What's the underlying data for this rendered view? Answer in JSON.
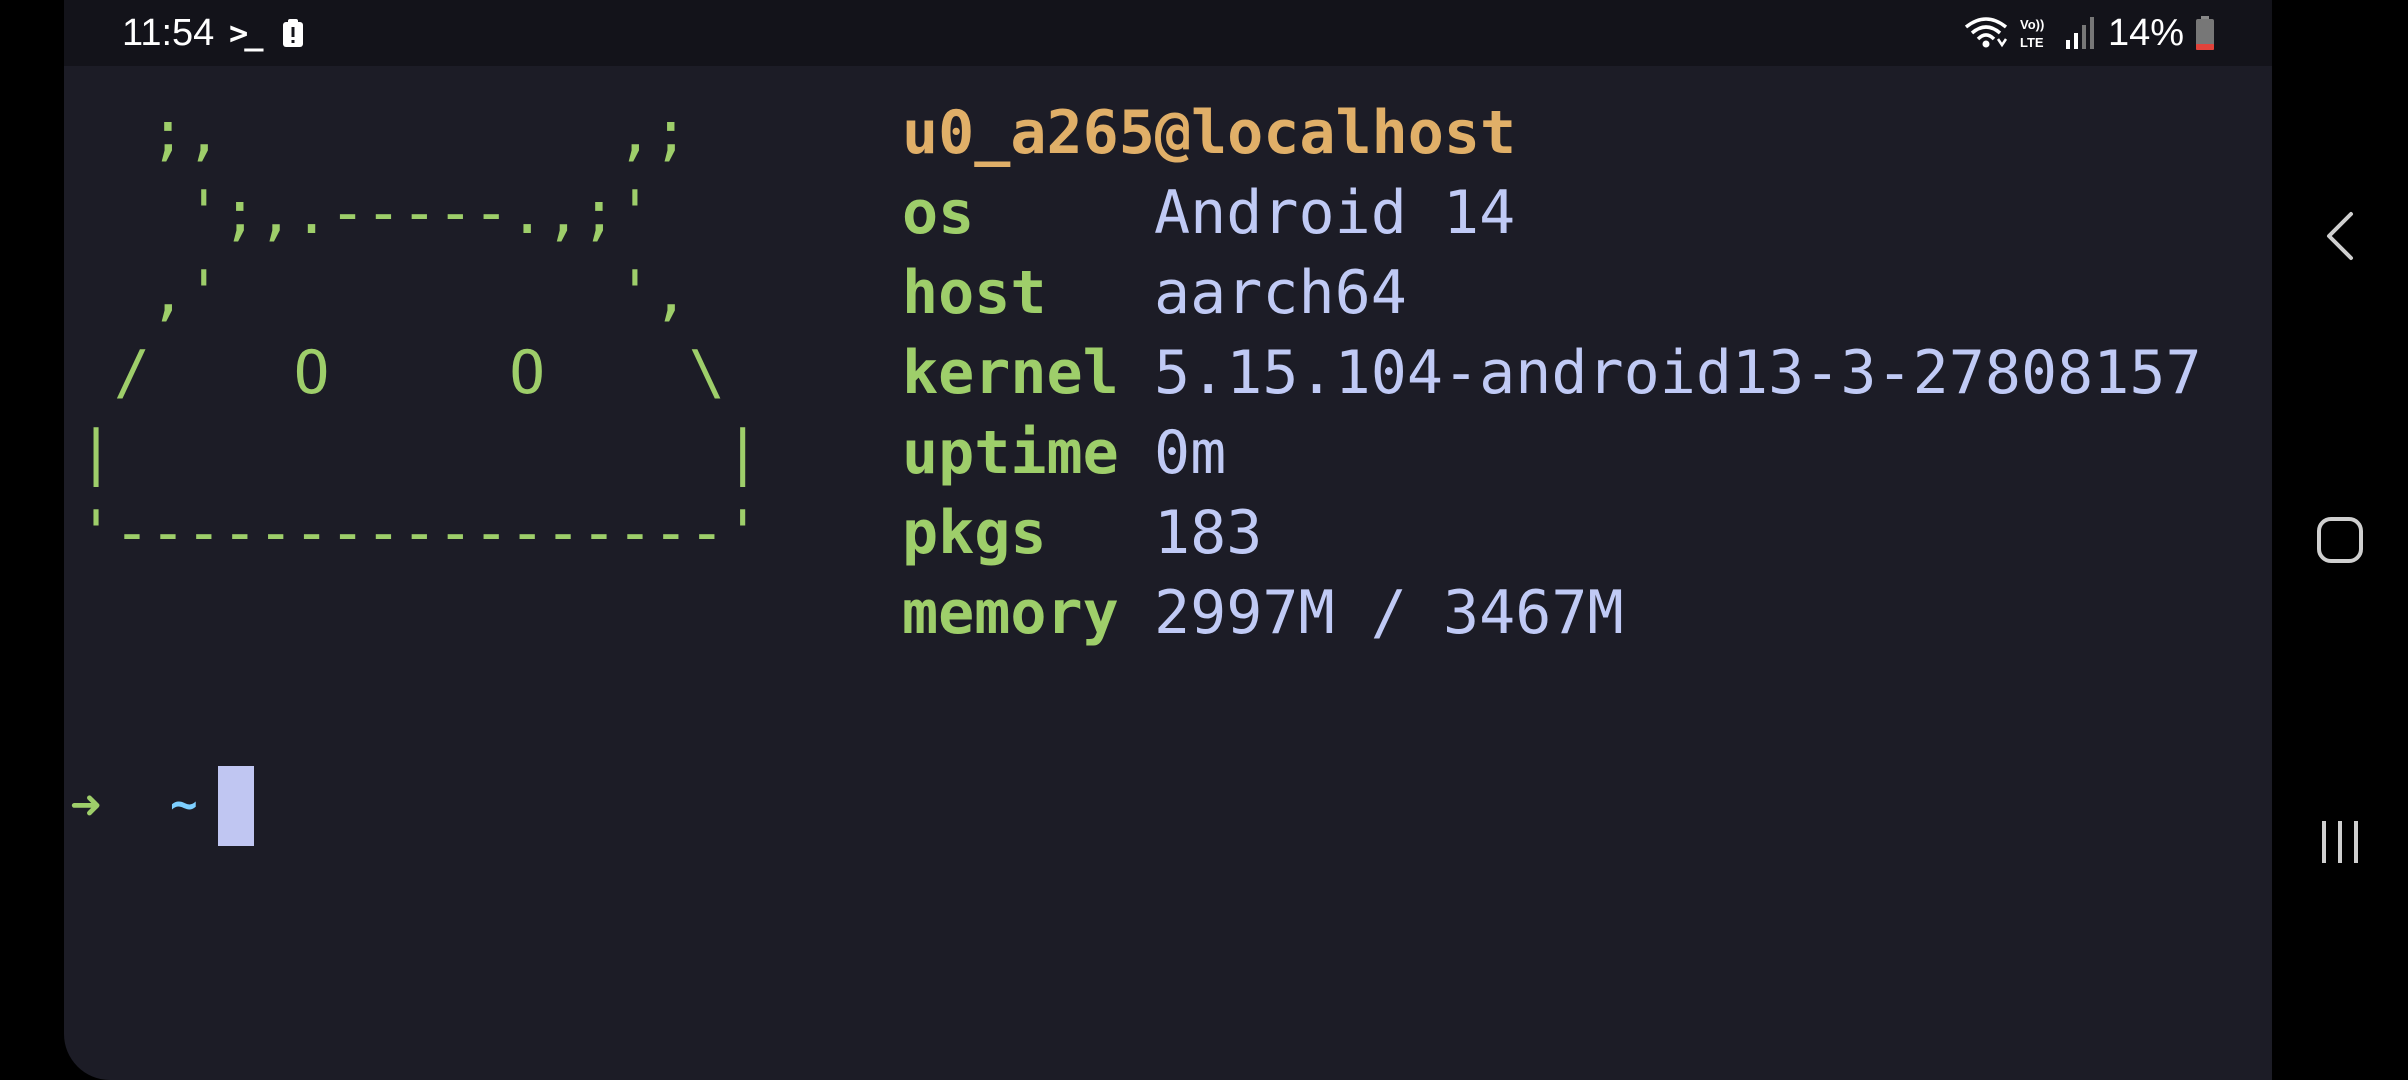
{
  "status_bar": {
    "time": "11:54",
    "terminal_icon": "terminal-prompt-icon",
    "clipboard_icon": "clipboard-alert-icon",
    "wifi_icon": "wifi-icon",
    "volte_icon": "volte-lte-icon",
    "signal_icon": "cell-signal-icon",
    "battery_percent": "14%",
    "battery_icon": "battery-low-icon",
    "battery_level": 0.14
  },
  "terminal": {
    "ascii_art": "  ;,           ,;\n   ';,.-----.,;'\n  ,'           ',\n /    O     O    \\\n|                 |\n'-----------------'",
    "user_host": "u0_a265@localhost",
    "info": [
      {
        "key": "os",
        "value": "Android 14"
      },
      {
        "key": "host",
        "value": "aarch64"
      },
      {
        "key": "kernel",
        "value": "5.15.104-android13-3-27808157"
      },
      {
        "key": "uptime",
        "value": "0m"
      },
      {
        "key": "pkgs",
        "value": "183"
      },
      {
        "key": "memory",
        "value": "2997M / 3467M"
      }
    ],
    "prompt_symbol": "➜",
    "prompt_dir": "~",
    "colors": {
      "background": "#1c1c26",
      "green": "#9ece6a",
      "orange": "#e0af68",
      "text": "#c0caf5",
      "cyan": "#7dcfff"
    }
  },
  "nav_bar": {
    "back_icon": "back-chevron-icon",
    "home_icon": "home-square-icon",
    "recents_icon": "recents-bars-icon"
  }
}
